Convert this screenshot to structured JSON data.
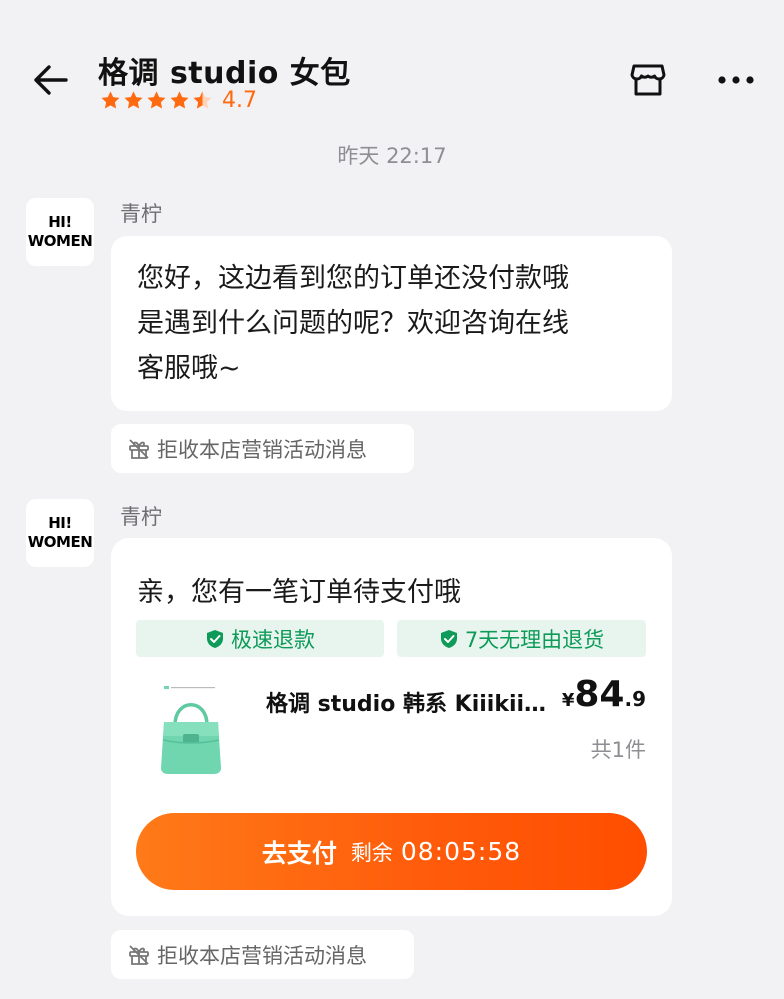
{
  "header": {
    "title": "格调 studio 女包",
    "rating": 4.5,
    "rating_label": "4.7",
    "back_icon": "arrow-left-icon",
    "store_icon": "store-icon",
    "more_icon": "more-dots-icon"
  },
  "chat": {
    "timestamp": "昨天 22:17",
    "avatar_text_line1": "HI!",
    "avatar_text_line2": "WOMEN",
    "messages": [
      {
        "sender": "青柠",
        "lines": [
          "您好，这边看到您的订单还没付款哦",
          "是遇到什么问题的呢？欢迎咨询在线",
          "客服哦~"
        ],
        "optout": "拒收本店营销活动消息"
      },
      {
        "sender": "青柠",
        "card": {
          "title": "亲，您有一笔订单待支付哦",
          "tags": [
            "极速退款",
            "7天无理由退货"
          ],
          "product_name": "格调 studio 韩系 Kiiikii…",
          "price_currency": "¥",
          "price_int": "84",
          "price_dec": ".9",
          "quantity": "共1件",
          "pay_label": "去支付",
          "remain_label": "剩余",
          "countdown": "08:05:58"
        },
        "optout": "拒收本店营销活动消息"
      }
    ]
  },
  "colors": {
    "accent": "#ff6a10",
    "tag_green": "#0e9a58",
    "tag_bg": "#e8f5ef",
    "bag_green": "#6fd6b0"
  }
}
